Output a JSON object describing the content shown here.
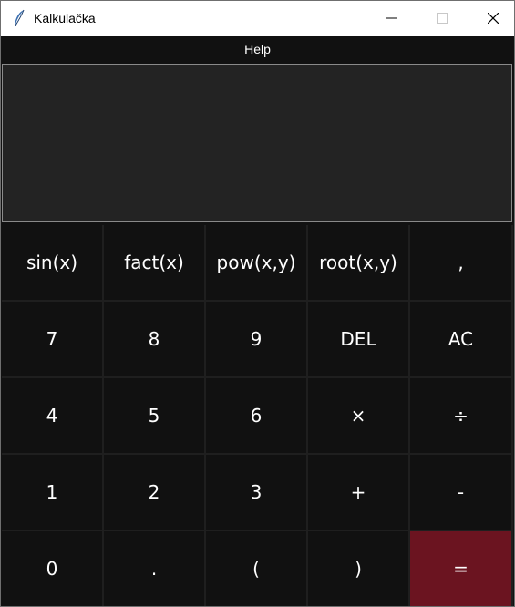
{
  "window": {
    "title": "Kalkulačka",
    "icon": "feather-icon",
    "controls": [
      "minimize-icon",
      "maximize-icon",
      "close-icon"
    ]
  },
  "menu": {
    "help_label": "Help"
  },
  "display": {
    "value": ""
  },
  "keys": [
    "sin(x)",
    "fact(x)",
    "pow(x,y)",
    "root(x,y)",
    ",",
    "7",
    "8",
    "9",
    "DEL",
    "AC",
    "4",
    "5",
    "6",
    "×",
    "÷",
    "1",
    "2",
    "3",
    "+",
    "-",
    "0",
    ".",
    "(",
    ")",
    "="
  ],
  "colors": {
    "background": "#111111",
    "display_bg": "#232323",
    "equals_bg": "#6b1420",
    "text": "#ffffff"
  }
}
